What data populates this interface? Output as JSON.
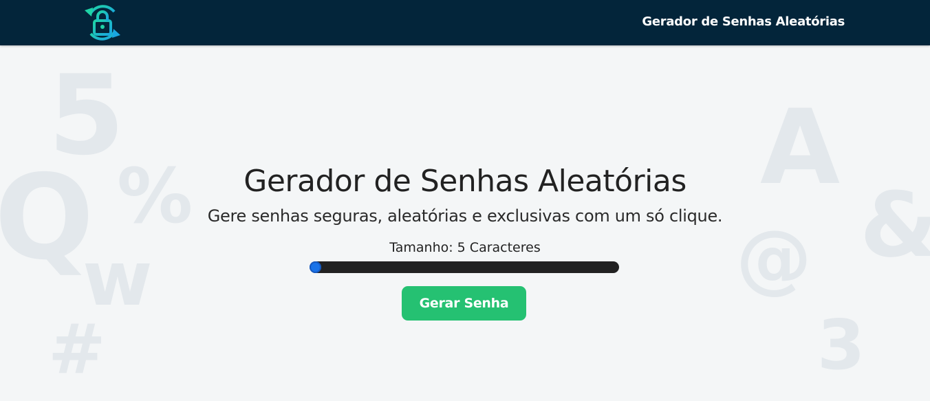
{
  "navbar": {
    "title": "Gerador de Senhas Aleatórias",
    "logo_icon": "refresh-lock-icon",
    "background_color": "#03253a"
  },
  "background_glyphs": [
    "5",
    "Q",
    "%",
    "w",
    "#",
    "A",
    "&",
    "@",
    "3"
  ],
  "main": {
    "heading": "Gerador de Senhas Aleatórias",
    "subheading": "Gere senhas seguras, aleatórias e exclusivas com um só clique.",
    "length_label": "Tamanho: 5 Caracteres",
    "slider": {
      "value": 5,
      "fill_fraction": 0.0
    },
    "button_label": "Gerar Senha",
    "button_color": "#25c172"
  }
}
